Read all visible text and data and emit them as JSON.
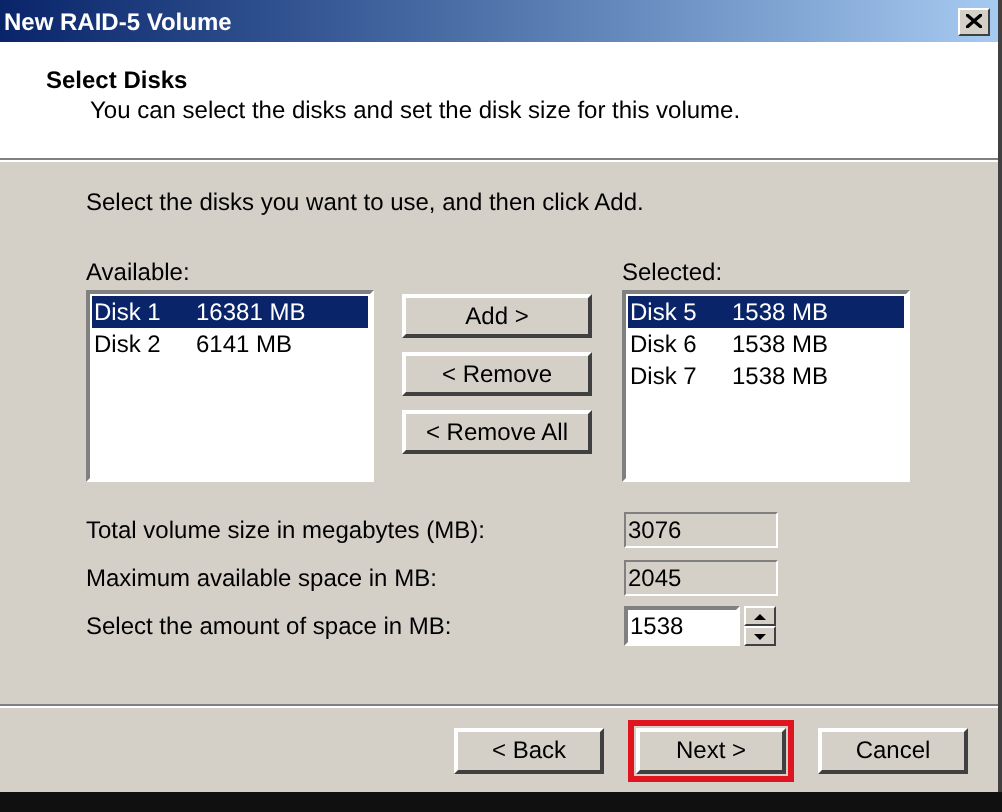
{
  "window": {
    "title": "New RAID-5 Volume"
  },
  "header": {
    "title": "Select Disks",
    "subtitle": "You can select the disks and set the disk size for this volume."
  },
  "instruction": "Select the disks you want to use, and then click Add.",
  "available": {
    "label": "Available:",
    "items": [
      {
        "disk": "Disk 1",
        "size": "16381 MB",
        "selected": true
      },
      {
        "disk": "Disk 2",
        "size": "6141 MB",
        "selected": false
      }
    ]
  },
  "move_buttons": [
    "Add >",
    "< Remove",
    "< Remove All"
  ],
  "selected_disks": {
    "label": "Selected:",
    "items": [
      {
        "disk": "Disk 5",
        "size": "1538 MB",
        "selected": true
      },
      {
        "disk": "Disk 6",
        "size": "1538 MB",
        "selected": false
      },
      {
        "disk": "Disk 7",
        "size": "1538 MB",
        "selected": false
      }
    ]
  },
  "fields": [
    {
      "label": "Total volume size in megabytes (MB):",
      "value": "3076",
      "kind": "readonly"
    },
    {
      "label": "Maximum available space in MB:",
      "value": "2045",
      "kind": "readonly"
    },
    {
      "label": "Select the amount of space in MB:",
      "value": "1538",
      "kind": "spinner"
    }
  ],
  "footer_buttons": [
    {
      "label": "< Back",
      "highlighted": false
    },
    {
      "label": "Next >",
      "highlighted": true
    },
    {
      "label": "Cancel",
      "highlighted": false
    }
  ]
}
